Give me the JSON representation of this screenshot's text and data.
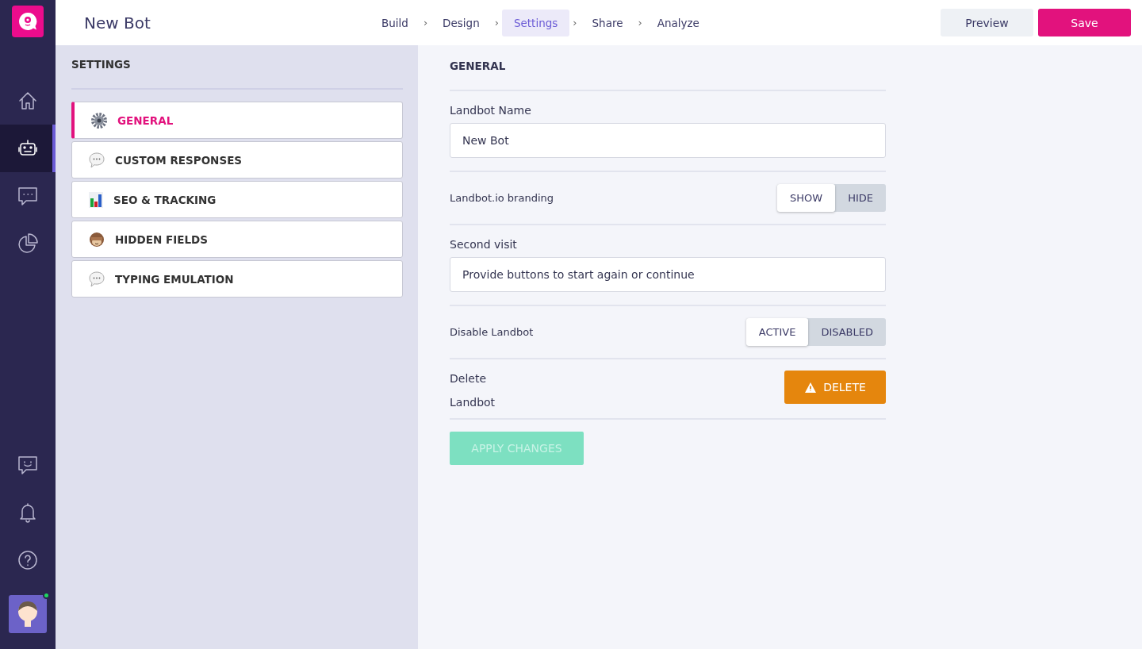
{
  "header": {
    "title": "New Bot",
    "steps": [
      {
        "label": "Build",
        "selected": false
      },
      {
        "label": "Design",
        "selected": false
      },
      {
        "label": "Settings",
        "selected": true
      },
      {
        "label": "Share",
        "selected": false
      },
      {
        "label": "Analyze",
        "selected": false
      }
    ],
    "separator": "›",
    "buttons": [
      {
        "label": "Preview",
        "kind": "secondary"
      },
      {
        "label": "Save",
        "kind": "primary"
      }
    ]
  },
  "rail": {
    "items": [
      {
        "kind": "home",
        "selected": false
      },
      {
        "kind": "bot",
        "selected": true
      },
      {
        "kind": "chat",
        "selected": false
      },
      {
        "kind": "pie",
        "selected": false
      }
    ],
    "bottom": [
      {
        "kind": "feedback"
      },
      {
        "kind": "bell"
      },
      {
        "kind": "help"
      }
    ],
    "user": {
      "online": true
    }
  },
  "settings_menu": {
    "title": "SETTINGS",
    "items": [
      {
        "label": "GENERAL",
        "selected": true,
        "kind": "gear"
      },
      {
        "label": "CUSTOM RESPONSES",
        "selected": false,
        "kind": "bubble"
      },
      {
        "label": "SEO & TRACKING",
        "selected": false,
        "kind": "chart"
      },
      {
        "label": "HIDDEN FIELDS",
        "selected": false,
        "kind": "monkey"
      },
      {
        "label": "TYPING EMULATION",
        "selected": false,
        "kind": "bubble"
      }
    ]
  },
  "general": {
    "title": "GENERAL",
    "rows": [
      {
        "kind": "field",
        "label": "Landbot Name",
        "value": "New Bot"
      },
      {
        "kind": "toggle",
        "label": "Landbot.io branding",
        "options": [
          {
            "label": "SHOW",
            "selected": true
          },
          {
            "label": "HIDE",
            "selected": false
          }
        ]
      },
      {
        "kind": "field",
        "label": "Second visit",
        "value": "Provide buttons to start again or continue"
      },
      {
        "kind": "toggle",
        "label": "Disable Landbot",
        "options": [
          {
            "label": "ACTIVE",
            "selected": true
          },
          {
            "label": "DISABLED",
            "selected": false
          }
        ]
      },
      {
        "kind": "delete",
        "label_lines": [
          "Delete",
          "Landbot"
        ],
        "button": "DELETE"
      }
    ],
    "apply": {
      "label": "APPLY CHANGES",
      "disabled": true
    }
  }
}
